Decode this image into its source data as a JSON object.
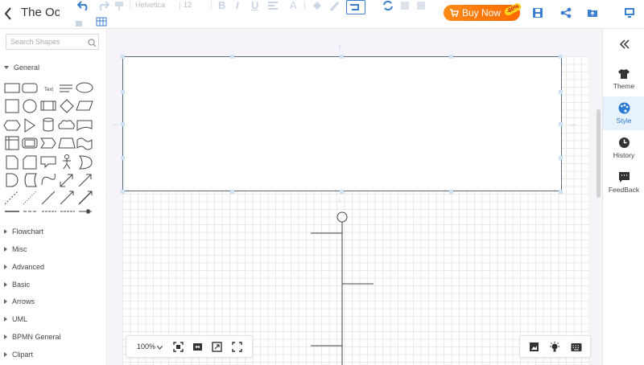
{
  "header": {
    "title": "The Octopus",
    "font": "Helvetica",
    "font_size": "12",
    "buy_label": "Buy Now",
    "discount": "-60%",
    "icons": [
      "back-icon",
      "undo-icon",
      "redo-icon",
      "format-painter-icon",
      "bold-icon",
      "italic-icon",
      "underline-icon",
      "align-icon",
      "font-color-icon",
      "fill-icon",
      "line-color-icon",
      "connector-icon",
      "arrange-icon",
      "table-icon",
      "save-icon",
      "share-icon",
      "export-icon",
      "present-icon"
    ]
  },
  "shapes_panel": {
    "search_placeholder": "Search Shapes",
    "general_label": "General",
    "categories": [
      "Flowchart",
      "Misc",
      "Advanced",
      "Basic",
      "Arrows",
      "UML",
      "BPMN General",
      "Clipart"
    ]
  },
  "canvas": {
    "zoom": "100%"
  },
  "right_panel": {
    "items": [
      {
        "label": "Theme",
        "icon": "tshirt-icon"
      },
      {
        "label": "Style",
        "icon": "palette-icon"
      },
      {
        "label": "History",
        "icon": "clock-icon"
      },
      {
        "label": "FeedBack",
        "icon": "feedback-icon"
      }
    ],
    "active": "Style"
  },
  "colors": {
    "accent": "#2a7ad5",
    "buy": "#ff7a0e",
    "canvas_bg": "#f7f4f9"
  }
}
